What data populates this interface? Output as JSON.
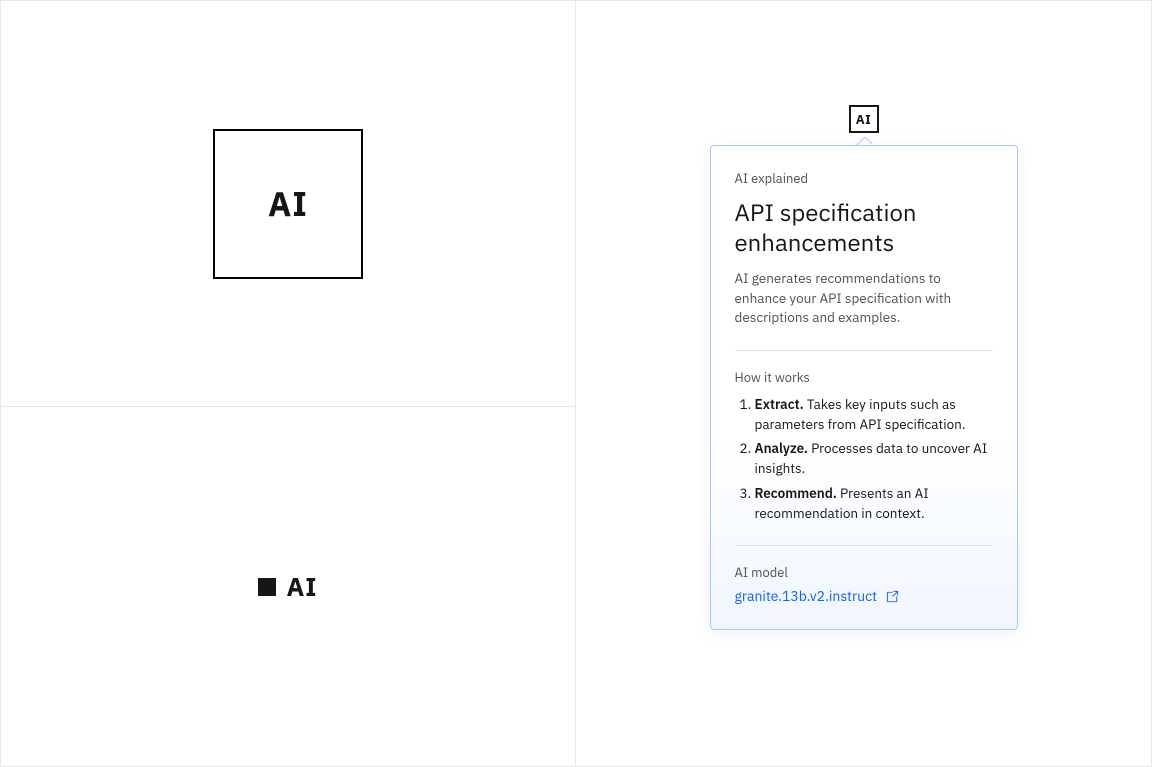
{
  "leftPanel": {
    "largeLabel": "AI",
    "smallLabel": "AI"
  },
  "rightPanel": {
    "triggerLabel": "AI",
    "card": {
      "eyebrow": "AI explained",
      "title": "API specification enhancements",
      "description": "AI generates recommendations to enhance your API specification with descriptions and examples.",
      "howItWorksLabel": "How it works",
      "steps": [
        {
          "title": "Extract.",
          "text": " Takes key inputs such as parameters from API specification."
        },
        {
          "title": "Analyze.",
          "text": " Processes data to uncover AI insights."
        },
        {
          "title": "Recommend.",
          "text": " Presents an AI recommendation in context."
        }
      ],
      "modelLabel": "AI model",
      "modelName": "granite.13b.v2.instruct"
    }
  }
}
